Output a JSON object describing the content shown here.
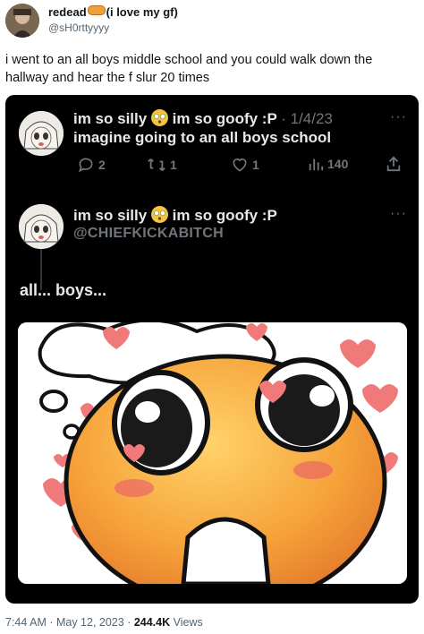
{
  "author": {
    "display_name": "redead",
    "display_suffix": "(i love my gf)",
    "handle": "@sH0rttyyyy"
  },
  "tweet": {
    "text": "i went to an all boys middle school and you could walk down the hallway and hear the f slur 20 times"
  },
  "quoted": {
    "post1": {
      "name_a": "im so silly",
      "name_b": "im so goofy :P",
      "date": "· 1/4/23",
      "text": "imagine going to an all boys school",
      "replies": "2",
      "retweets": "1",
      "likes": "1",
      "views": "140"
    },
    "post2": {
      "name_a": "im so silly",
      "name_b": "im so goofy :P",
      "handle": "@CHIEFKICKABITCH",
      "text": "all... boys..."
    }
  },
  "footer": {
    "time_date": "7:44 AM · May 12, 2023 · ",
    "views_count": "244.4K",
    "views_label": " Views"
  },
  "colors": {
    "dark_bg": "#000000",
    "heart_pink": "#f07a7a",
    "emoji_orange": "#f29a2e"
  },
  "icons": [
    "reply-icon",
    "retweet-icon",
    "like-icon",
    "views-icon",
    "share-icon",
    "more-icon"
  ]
}
